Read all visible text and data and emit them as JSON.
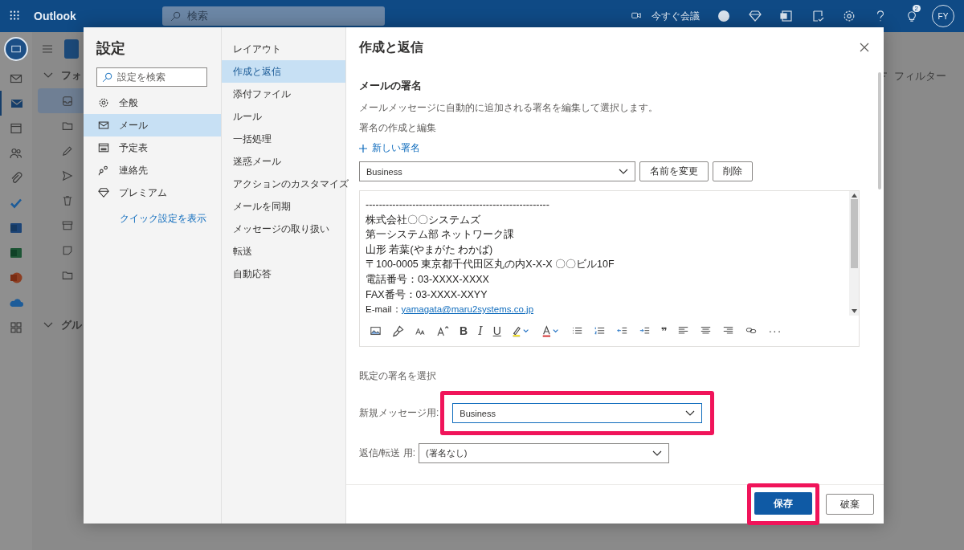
{
  "topbar": {
    "app_title": "Outlook",
    "search_placeholder": "検索",
    "meet_now": "今すぐ会議",
    "notification_count": "2",
    "avatar": "FY"
  },
  "rail": [
    {
      "kind": "compose",
      "selected": false
    },
    {
      "kind": "mail",
      "selected": true
    },
    {
      "kind": "calendar",
      "selected": false
    },
    {
      "kind": "people",
      "selected": false
    },
    {
      "kind": "attach",
      "selected": false
    },
    {
      "kind": "todo",
      "selected": false
    },
    {
      "kind": "word",
      "selected": false
    },
    {
      "kind": "excel",
      "selected": false
    },
    {
      "kind": "powerpoint",
      "selected": false
    },
    {
      "kind": "cloud",
      "selected": false
    },
    {
      "kind": "apps",
      "selected": false
    }
  ],
  "folder_pane": {
    "folders_heading": "フォ",
    "folders": [
      {
        "kind": "inbox",
        "selected": true
      },
      {
        "kind": "folder",
        "selected": false
      },
      {
        "kind": "draft",
        "selected": false
      },
      {
        "kind": "sent",
        "selected": false
      },
      {
        "kind": "trash",
        "selected": false
      },
      {
        "kind": "archive",
        "selected": false
      },
      {
        "kind": "note",
        "selected": false
      },
      {
        "kind": "folder",
        "selected": false
      }
    ],
    "groups_heading": "グル"
  },
  "filter": "フィルター",
  "settings": {
    "title": "設定",
    "search_placeholder": "設定を検索",
    "categories": [
      {
        "label": "全般",
        "kind": "gear",
        "selected": false
      },
      {
        "label": "メール",
        "kind": "mail",
        "selected": true
      },
      {
        "label": "予定表",
        "kind": "calendar",
        "selected": false
      },
      {
        "label": "連絡先",
        "kind": "people",
        "selected": false
      },
      {
        "label": "プレミアム",
        "kind": "diamond",
        "selected": false
      }
    ],
    "quick_link": "クイック設定を表示",
    "subcategories": [
      {
        "label": "レイアウト",
        "selected": false
      },
      {
        "label": "作成と返信",
        "selected": true
      },
      {
        "label": "添付ファイル",
        "selected": false
      },
      {
        "label": "ルール",
        "selected": false
      },
      {
        "label": "一括処理",
        "selected": false
      },
      {
        "label": "迷惑メール",
        "selected": false
      },
      {
        "label": "アクションのカスタマイズ",
        "selected": false
      },
      {
        "label": "メールを同期",
        "selected": false
      },
      {
        "label": "メッセージの取り扱い",
        "selected": false
      },
      {
        "label": "転送",
        "selected": false
      },
      {
        "label": "自動応答",
        "selected": false
      }
    ],
    "content": {
      "title": "作成と返信",
      "section_title": "メールの署名",
      "description": "メールメッセージに自動的に追加される署名を編集して選択します。",
      "edit_label": "署名の作成と編集",
      "new_signature": "新しい署名",
      "signature_select": "Business",
      "rename_button": "名前を変更",
      "delete_button": "削除",
      "signature_lines": [
        "-------------------------------------------------------",
        "株式会社〇〇システムズ",
        "第一システム部 ネットワーク課",
        "山形 若葉(やまがた わかば)",
        "〒100-0005 東京都千代田区丸の内X-X-X 〇〇ビル10F",
        "電話番号：03-XXXX-XXXX",
        "FAX番号：03-XXXX-XXYY"
      ],
      "email_label": "E-mail：",
      "email": "yamagata@maru2systems.co.jp",
      "toolbar": [
        {
          "kind": "image"
        },
        {
          "kind": "brush"
        },
        {
          "kind": "fontsize"
        },
        {
          "kind": "grow"
        },
        {
          "kind": "bold",
          "label": "B"
        },
        {
          "kind": "italic",
          "label": "I"
        },
        {
          "kind": "underline",
          "label": "U"
        },
        {
          "kind": "highlight"
        },
        {
          "kind": "fontcolor"
        },
        {
          "kind": "bullets"
        },
        {
          "kind": "numbers"
        },
        {
          "kind": "outdent"
        },
        {
          "kind": "indent"
        },
        {
          "kind": "quote",
          "label": "❞"
        },
        {
          "kind": "left"
        },
        {
          "kind": "center"
        },
        {
          "kind": "right"
        },
        {
          "kind": "link"
        },
        {
          "kind": "more",
          "label": "···"
        }
      ],
      "defaults_label": "既定の署名を選択",
      "new_message": {
        "label": "新規メッセージ用:",
        "value": "Business",
        "highlighted": true
      },
      "reply_forward": {
        "label": "返信/転送 用:",
        "value": "(署名なし)"
      }
    },
    "footer": {
      "save": {
        "label": "保存",
        "highlighted": true
      },
      "discard": {
        "label": "破棄"
      }
    }
  }
}
